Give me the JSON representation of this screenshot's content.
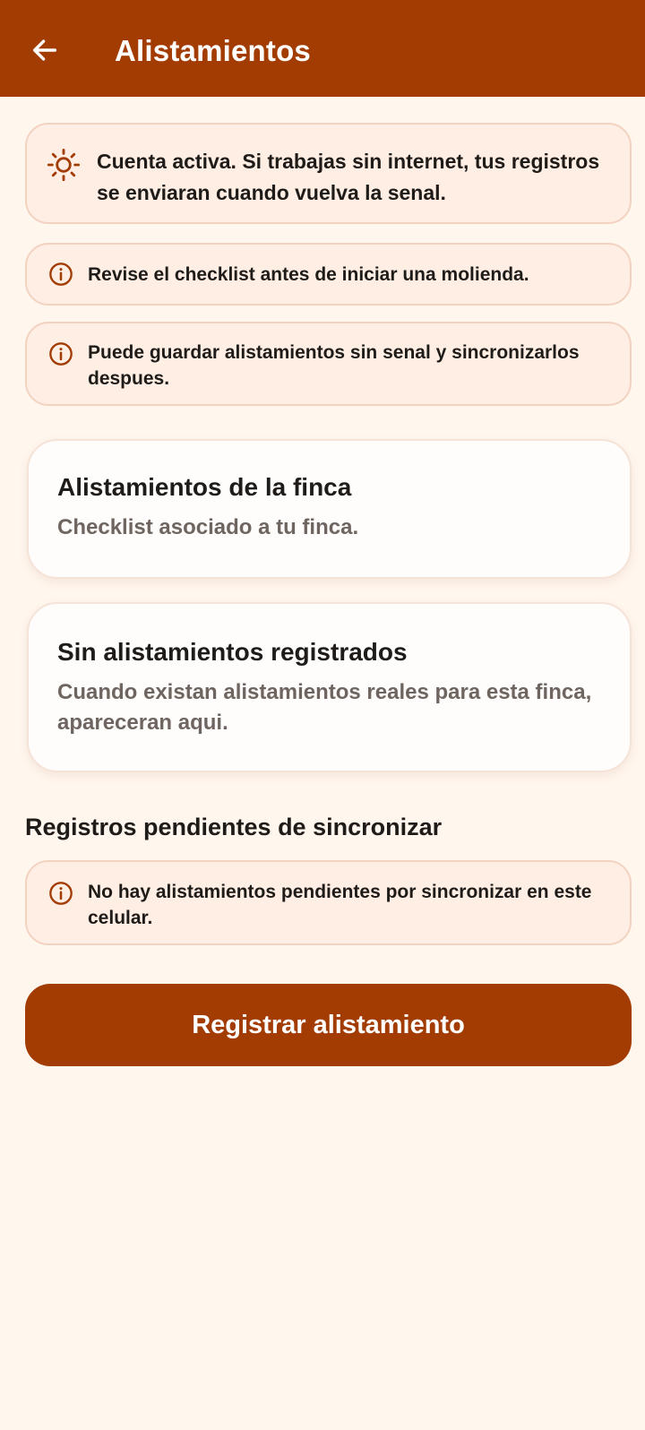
{
  "appbar": {
    "title": "Alistamientos",
    "back_icon": "arrow-left-icon"
  },
  "status_banner": {
    "icon": "sun-icon",
    "text": "Cuenta activa. Si trabajas sin internet, tus registros se enviaran cuando vuelva la senal."
  },
  "info_banners": [
    {
      "icon": "info-circle-icon",
      "text": "Revise el checklist antes de iniciar una molienda."
    },
    {
      "icon": "info-circle-icon",
      "text": "Puede guardar alistamientos sin senal y sincronizarlos despues."
    }
  ],
  "cards": [
    {
      "title": "Alistamientos de la finca",
      "description": "Checklist asociado a tu finca."
    },
    {
      "title": "Sin alistamientos registrados",
      "description": "Cuando existan alistamientos reales para esta finca, apareceran aqui."
    }
  ],
  "pending_section": {
    "heading": "Registros pendientes de sincronizar",
    "banner": {
      "icon": "info-circle-icon",
      "text": "No hay alistamientos pendientes por sincronizar en este celular."
    }
  },
  "primary_action": {
    "label": "Registrar alistamiento"
  },
  "colors": {
    "primary": "#A23C02",
    "background": "#FFF6EE",
    "banner_bg": "#FEEEE4",
    "banner_border": "#F3D2C0",
    "card_bg": "#FFFDFB",
    "muted_text": "#6F6560"
  }
}
